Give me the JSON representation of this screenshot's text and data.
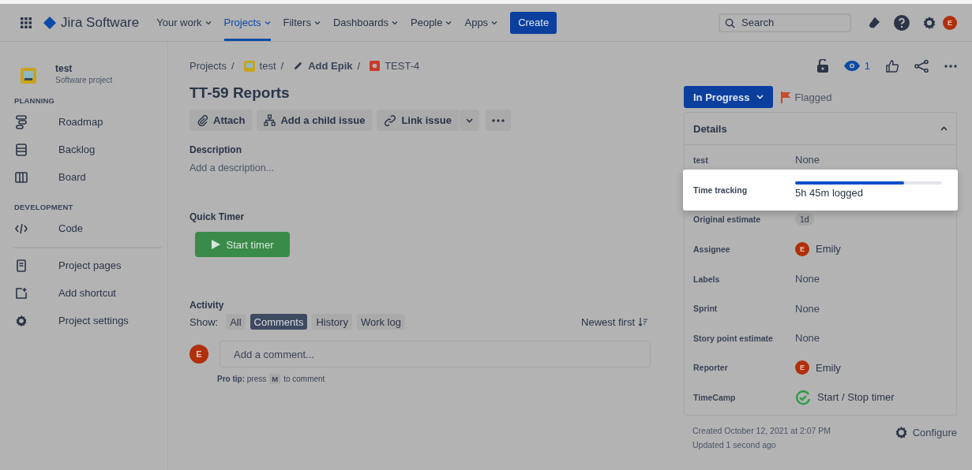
{
  "nav": {
    "product": "Jira Software",
    "items": [
      {
        "label": "Your work",
        "selected": false
      },
      {
        "label": "Projects",
        "selected": true
      },
      {
        "label": "Filters",
        "selected": false
      },
      {
        "label": "Dashboards",
        "selected": false
      },
      {
        "label": "People",
        "selected": false
      },
      {
        "label": "Apps",
        "selected": false
      }
    ],
    "create": "Create",
    "search": {
      "placeholder": "Search"
    },
    "avatar": "E"
  },
  "sidebar": {
    "project": {
      "name": "test",
      "subtitle": "Software project"
    },
    "sections": [
      {
        "heading": "PLANNING",
        "items": [
          "Roadmap",
          "Backlog",
          "Board"
        ]
      },
      {
        "heading": "DEVELOPMENT",
        "items": [
          "Code"
        ]
      }
    ],
    "extra": [
      "Project pages",
      "Add shortcut",
      "Project settings"
    ]
  },
  "breadcrumbs": [
    {
      "label": "Projects",
      "separator": "/"
    },
    {
      "label": "test",
      "separator": "/"
    },
    {
      "label": "Add Epik",
      "separator": "/"
    },
    {
      "label": "TEST-4"
    }
  ],
  "issue": {
    "title": "TT-59 Reports",
    "actions": [
      "Attach",
      "Add a child issue",
      "Link issue"
    ],
    "description": {
      "heading": "Description",
      "placeholder": "Add a description..."
    },
    "timer": {
      "heading": "Quick Timer",
      "button": "Start timer"
    },
    "activity": {
      "heading": "Activity",
      "show": "Show:",
      "filters": [
        {
          "label": "All",
          "selected": false
        },
        {
          "label": "Comments",
          "selected": true
        },
        {
          "label": "History",
          "selected": false
        },
        {
          "label": "Work log",
          "selected": false
        }
      ],
      "sort": "Newest first",
      "avatar": "E",
      "comment": {
        "placeholder": "Add a comment..."
      },
      "pro_tip": {
        "text": "**Pro tip:** press",
        "key": "M",
        "after": "to comment"
      }
    }
  },
  "side": {
    "watchers": "1",
    "status": "In Progress",
    "flag": "Flagged",
    "details": {
      "heading": "Details",
      "expanded": true,
      "rows": [
        {
          "kind": "text",
          "label": "test",
          "value": "None"
        },
        {
          "kind": "tracking",
          "label": "Time tracking",
          "value": "5h 45m logged",
          "level": 0.74,
          "highlighted": true
        },
        {
          "kind": "lozenge",
          "label": "Original estimate",
          "value": "1d"
        },
        {
          "kind": "user",
          "label": "Assignee",
          "value": "Emily",
          "avatar": "E"
        },
        {
          "kind": "text",
          "label": "Labels",
          "value": "None"
        },
        {
          "kind": "text",
          "label": "Sprint",
          "value": "None"
        },
        {
          "kind": "text",
          "label": "Story point estimate",
          "value": "None"
        },
        {
          "kind": "user",
          "label": "Reporter",
          "value": "Emily",
          "avatar": "E"
        },
        {
          "kind": "timer",
          "label": "TimeCamp",
          "value": "Start / Stop timer"
        }
      ]
    },
    "created": "Created October 12, 2021 at 2:07 PM",
    "updated": "Updated 1 second ago",
    "configure": "Configure"
  }
}
